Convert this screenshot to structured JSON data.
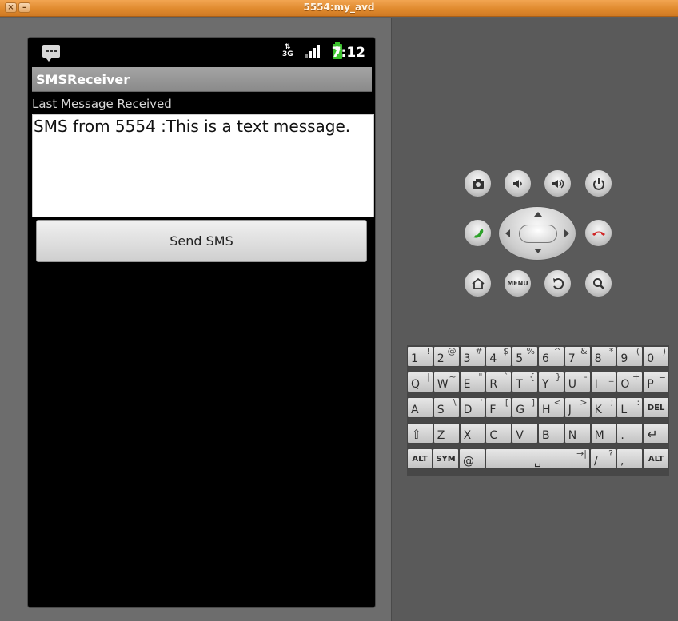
{
  "window": {
    "title": "5554:my_avd",
    "close_label": "×",
    "minimize_label": "–"
  },
  "status_bar": {
    "time": "7:12",
    "network": "3G",
    "icons": [
      "sms-notification-icon",
      "3g-data-icon",
      "signal-strength-icon",
      "battery-charging-icon"
    ]
  },
  "app": {
    "title": "SMSReceiver",
    "last_message_label": "Last Message Received",
    "message_text": "SMS from 5554 :This is a text message.",
    "send_button": "Send SMS"
  },
  "controls": {
    "menu_label": "MENU",
    "buttons": [
      "camera-icon",
      "volume-down-icon",
      "volume-up-icon",
      "power-icon",
      "call-icon",
      "dpad",
      "end-call-icon",
      "home-icon",
      "menu-button",
      "back-icon",
      "search-icon"
    ]
  },
  "keyboard": {
    "row1": [
      [
        "1",
        "!"
      ],
      [
        "2",
        "@"
      ],
      [
        "3",
        "#"
      ],
      [
        "4",
        "$"
      ],
      [
        "5",
        "%"
      ],
      [
        "6",
        "^"
      ],
      [
        "7",
        "&"
      ],
      [
        "8",
        "*"
      ],
      [
        "9",
        "("
      ],
      [
        "0",
        ")"
      ]
    ],
    "row2": [
      [
        "Q",
        "|"
      ],
      [
        "W",
        "~"
      ],
      [
        "E",
        "\""
      ],
      [
        "R",
        "`"
      ],
      [
        "T",
        "{"
      ],
      [
        "Y",
        "}"
      ],
      [
        "U",
        "-"
      ],
      [
        "I",
        "_"
      ],
      [
        "O",
        "+"
      ],
      [
        "P",
        "="
      ]
    ],
    "row3": [
      [
        "A",
        ""
      ],
      [
        "S",
        "\\"
      ],
      [
        "D",
        "'"
      ],
      [
        "F",
        "["
      ],
      [
        "G",
        "]"
      ],
      [
        "H",
        "<"
      ],
      [
        "J",
        ">"
      ],
      [
        "K",
        ";"
      ],
      [
        "L",
        ":"
      ],
      [
        "DEL",
        ""
      ]
    ],
    "row4": [
      [
        "⇧",
        ""
      ],
      [
        "Z",
        ""
      ],
      [
        "X",
        ""
      ],
      [
        "C",
        ""
      ],
      [
        "V",
        ""
      ],
      [
        "B",
        ""
      ],
      [
        "N",
        ""
      ],
      [
        "M",
        ""
      ],
      [
        ".",
        ""
      ],
      [
        "↵",
        ""
      ]
    ],
    "row5": {
      "alt_left": "ALT",
      "sym": "SYM",
      "at": "@",
      "space": "␣",
      "tab": "→|",
      "slash": "/",
      "question": "?",
      "comma": ",",
      "alt_right": "ALT"
    }
  },
  "colors": {
    "titlebar": "#e08a2e",
    "battery": "#3cc22e",
    "call": "#2ea12a",
    "end_call": "#d02626"
  }
}
